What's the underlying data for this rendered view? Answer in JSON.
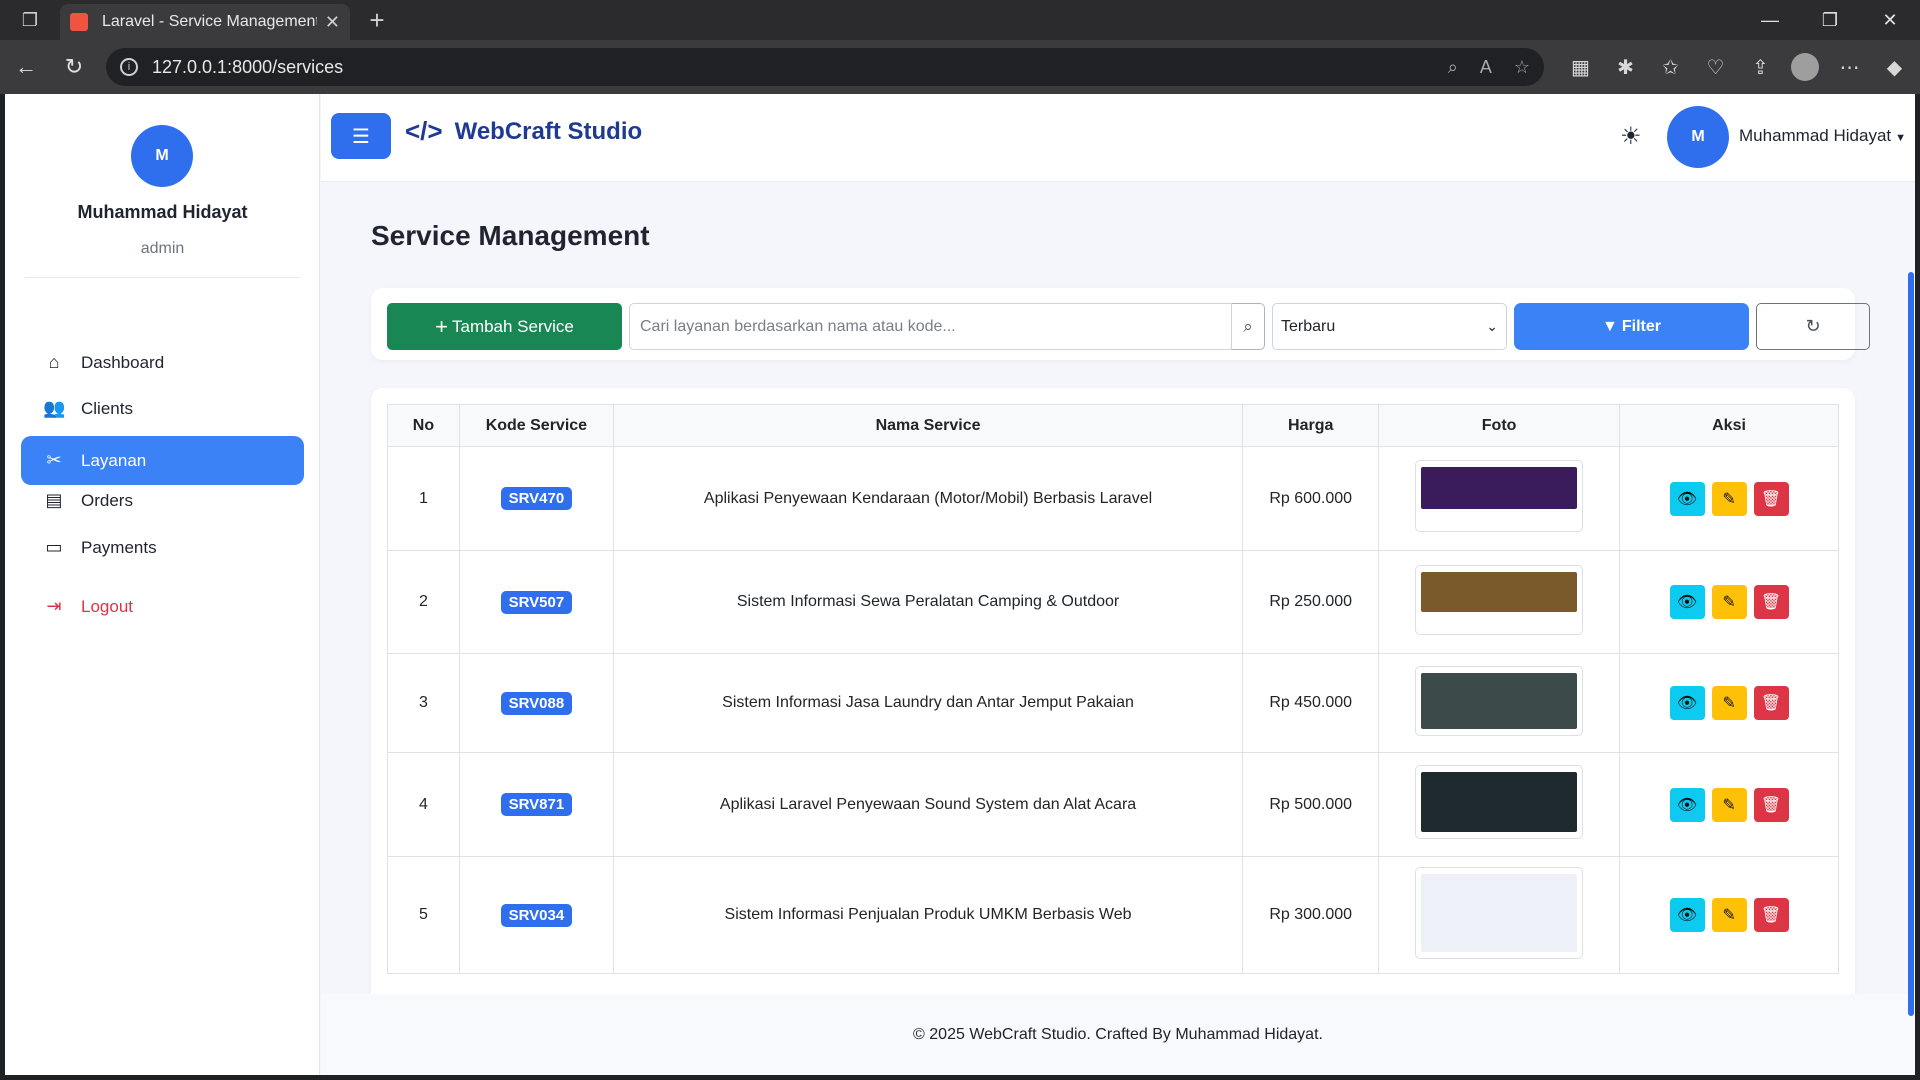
{
  "browser": {
    "tab_title": "Laravel - Service Management",
    "url": "127.0.0.1:8000/services"
  },
  "sidebar": {
    "avatar_initial": "M",
    "user_name": "Muhammad Hidayat",
    "user_role": "admin",
    "items": [
      {
        "label": "Dashboard",
        "icon": "home-icon"
      },
      {
        "label": "Clients",
        "icon": "users-icon"
      },
      {
        "label": "Layanan",
        "icon": "tools-icon",
        "active": true
      },
      {
        "label": "Orders",
        "icon": "receipt-icon"
      },
      {
        "label": "Payments",
        "icon": "credit-card-icon"
      }
    ],
    "logout_label": "Logout"
  },
  "topbar": {
    "brand": "WebCraft Studio",
    "avatar_initial": "M",
    "user_name": "Muhammad Hidayat"
  },
  "page": {
    "title": "Service Management"
  },
  "toolbar": {
    "add_label": "Tambah Service",
    "search_placeholder": "Cari layanan berdasarkan nama atau kode...",
    "sort_value": "Terbaru",
    "filter_label": "Filter"
  },
  "table": {
    "headers": [
      "No",
      "Kode Service",
      "Nama Service",
      "Harga",
      "Foto",
      "Aksi"
    ],
    "rows": [
      {
        "no": "1",
        "kode": "SRV470",
        "nama": "Aplikasi Penyewaan Kendaraan (Motor/Mobil) Berbasis Laravel",
        "harga": "Rp 600.000",
        "thumb_color": "#3a1c5c"
      },
      {
        "no": "2",
        "kode": "SRV507",
        "nama": "Sistem Informasi Sewa Peralatan Camping & Outdoor",
        "harga": "Rp 250.000",
        "thumb_color": "#7a5a2a"
      },
      {
        "no": "3",
        "kode": "SRV088",
        "nama": "Sistem Informasi Jasa Laundry dan Antar Jemput Pakaian",
        "harga": "Rp 450.000",
        "thumb_color": "#3c4a4a"
      },
      {
        "no": "4",
        "kode": "SRV871",
        "nama": "Aplikasi Laravel Penyewaan Sound System dan Alat Acara",
        "harga": "Rp 500.000",
        "thumb_color": "#1f2a2e"
      },
      {
        "no": "5",
        "kode": "SRV034",
        "nama": "Sistem Informasi Penjualan Produk UMKM Berbasis Web",
        "harga": "Rp 300.000",
        "thumb_color": "#eef0f8"
      }
    ]
  },
  "footer": {
    "text": "© 2025 WebCraft Studio. Crafted By Muhammad Hidayat."
  },
  "colors": {
    "primary": "#3b82f6",
    "success": "#198754",
    "info": "#0dcaf0",
    "warning": "#ffc107",
    "danger": "#dc3545"
  }
}
